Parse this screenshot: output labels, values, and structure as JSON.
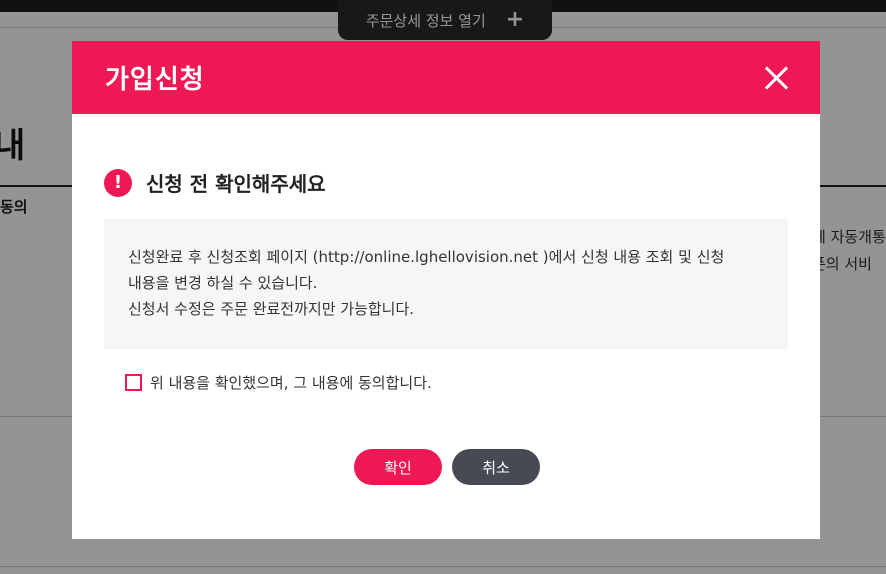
{
  "background": {
    "order_tab_label": "주문상세 정보 열기",
    "order_tab_plus": "+",
    "heading_fragment": "내",
    "agree_fragment": "동의",
    "right_text_1": "에 자동개통",
    "right_text_2": "폰의 서비"
  },
  "modal": {
    "title": "가입신청",
    "close_icon": "close-icon",
    "notice_icon_symbol": "!",
    "notice_title": "신청 전 확인해주세요",
    "info_lines": [
      "신청완료 후 신청조회 페이지 (http://online.lghellovision.net )에서 신청 내용 조회 및 신청",
      "내용을 변경 하실 수 있습니다.",
      "신청서 수정은 주문 완료전까지만 가능합니다."
    ],
    "agree_label": "위 내용을 확인했으며, 그 내용에 동의합니다.",
    "agree_checked": false,
    "confirm_label": "확인",
    "cancel_label": "취소"
  },
  "colors": {
    "accent": "#ee1854",
    "cancel_button": "#474a55",
    "info_box_bg": "#f6f6f6"
  }
}
